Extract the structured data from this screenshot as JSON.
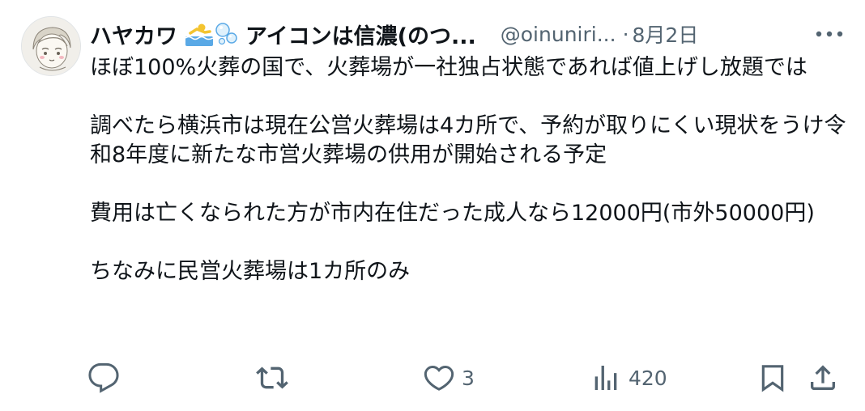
{
  "user": {
    "name_part1": "ハヤカワ",
    "name_part2": "アイコンは信濃(のつ...",
    "handle": "@oinuniri...",
    "separator": "·",
    "date": "8月2日"
  },
  "icons": {
    "avatar": "avatar-sketch",
    "emoji1": "person-swimming-emoji",
    "emoji2": "bubbles-emoji",
    "more": "more-horizontal-icon",
    "reply": "reply-icon",
    "retweet": "retweet-icon",
    "like": "heart-icon",
    "views": "views-bar-chart-icon",
    "bookmark": "bookmark-icon",
    "share": "share-icon"
  },
  "tweet": {
    "text": "ほぼ100%火葬の国で、火葬場が一社独占状態であれば値上げし放題では\n\n調べたら横浜市は現在公営火葬場は4カ所で、予約が取りにくい現状をうけ令和8年度に新たな市営火葬場の供用が開始される予定\n\n費用は亡くなられた方が市内在住だった成人なら12000円(市外50000円)\n\nちなみに民営火葬場は1カ所のみ"
  },
  "actions": {
    "like_count": "3",
    "views_count": "420"
  },
  "colors": {
    "text": "#0f1419",
    "secondary": "#536471",
    "emoji_blue": "#5aa9e6",
    "emoji_yellow": "#f4c430"
  }
}
